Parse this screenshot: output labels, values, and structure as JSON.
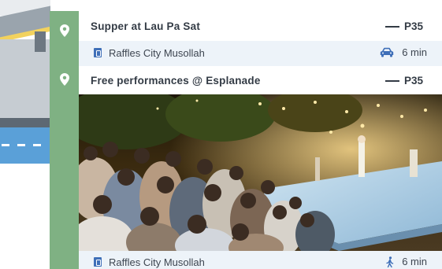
{
  "itinerary": {
    "items": [
      {
        "title": "Supper at Lau Pa Sat",
        "price": "P35",
        "location": "Raffles City Musollah",
        "travel_mode": "car-icon",
        "duration": "6 min"
      },
      {
        "title": "Free performances @ Esplanade",
        "price": "P35",
        "location": "Raffles City Musollah",
        "travel_mode": "walking-person-icon",
        "duration": "6 min"
      }
    ]
  },
  "colors": {
    "timeline_green": "#7fb183",
    "pin_white": "#ffffff",
    "location_icon_blue": "#3f6fb8",
    "subrow_bg": "#edf3f9",
    "text_dark": "#333b45"
  }
}
